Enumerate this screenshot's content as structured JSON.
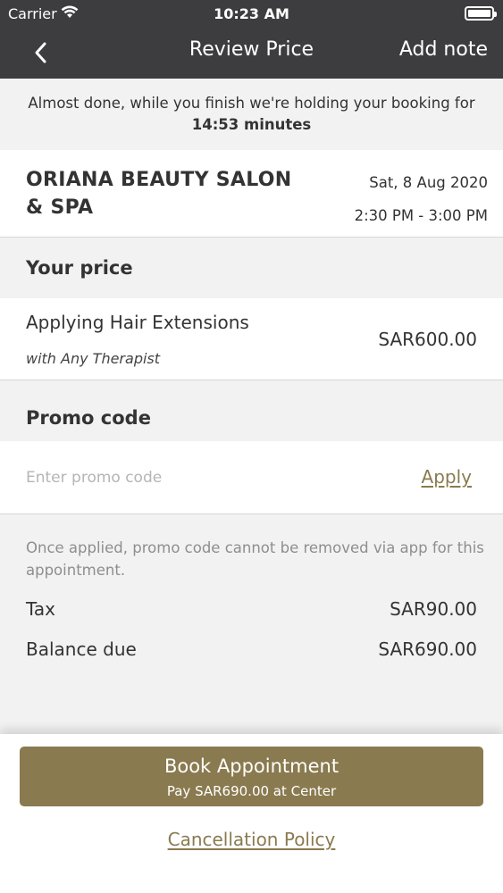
{
  "status_bar": {
    "carrier": "Carrier",
    "time": "10:23 AM",
    "wifi_icon": "wifi-icon",
    "battery_icon": "battery-icon"
  },
  "nav": {
    "title": "Review Price",
    "add_note": "Add note",
    "back_icon": "chevron-left-icon"
  },
  "hold": {
    "message": "Almost done, while you finish we're holding your booking for",
    "minutes": "14:53 minutes"
  },
  "booking": {
    "salon_name": "ORIANA BEAUTY SALON & SPA",
    "date": "Sat, 8 Aug 2020",
    "time_slot": "2:30 PM - 3:00 PM"
  },
  "your_price": {
    "heading": "Your price",
    "service_name": "Applying Hair Extensions",
    "therapist": "with Any Therapist",
    "price": "SAR600.00"
  },
  "promo": {
    "heading": "Promo code",
    "placeholder": "Enter promo code",
    "value": "",
    "apply_label": "Apply",
    "note": "Once applied, promo code cannot be removed via app for this appointment."
  },
  "summary": {
    "tax_label": "Tax",
    "tax_value": "SAR90.00",
    "balance_label": "Balance due",
    "balance_value": "SAR690.00"
  },
  "footer": {
    "book_label": "Book Appointment",
    "book_sub": "Pay SAR690.00 at Center",
    "cancellation_label": "Cancellation Policy"
  },
  "colors": {
    "nav_bg": "#3d3d3f",
    "accent": "#8a7a4f",
    "page_bg": "#f2f2f2"
  }
}
